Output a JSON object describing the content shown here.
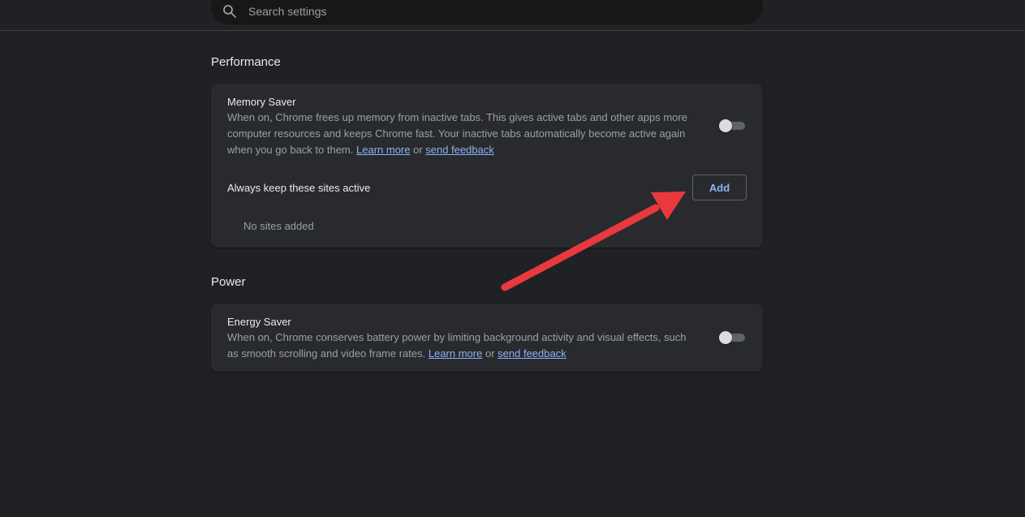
{
  "search": {
    "placeholder": "Search settings"
  },
  "performance": {
    "title": "Performance",
    "memory_saver": {
      "title": "Memory Saver",
      "description": "When on, Chrome frees up memory from inactive tabs. This gives active tabs and other apps more computer resources and keeps Chrome fast. Your inactive tabs automatically become active again when you go back to them.",
      "learn_more": "Learn more",
      "or": "or",
      "send_feedback": "send feedback",
      "enabled": false
    },
    "always_active": {
      "label": "Always keep these sites active",
      "add_label": "Add",
      "empty_text": "No sites added"
    }
  },
  "power": {
    "title": "Power",
    "energy_saver": {
      "title": "Energy Saver",
      "description": "When on, Chrome conserves battery power by limiting background activity and visual effects, such as smooth scrolling and video frame rates.",
      "learn_more": "Learn more",
      "or": "or",
      "send_feedback": "send feedback",
      "enabled": false
    }
  },
  "colors": {
    "background": "#202124",
    "card": "#292a2d",
    "link": "#8ab4f8",
    "annotation_arrow": "#e8393f"
  },
  "icons": {
    "search": "search-icon",
    "arrow": "annotation-arrow"
  }
}
